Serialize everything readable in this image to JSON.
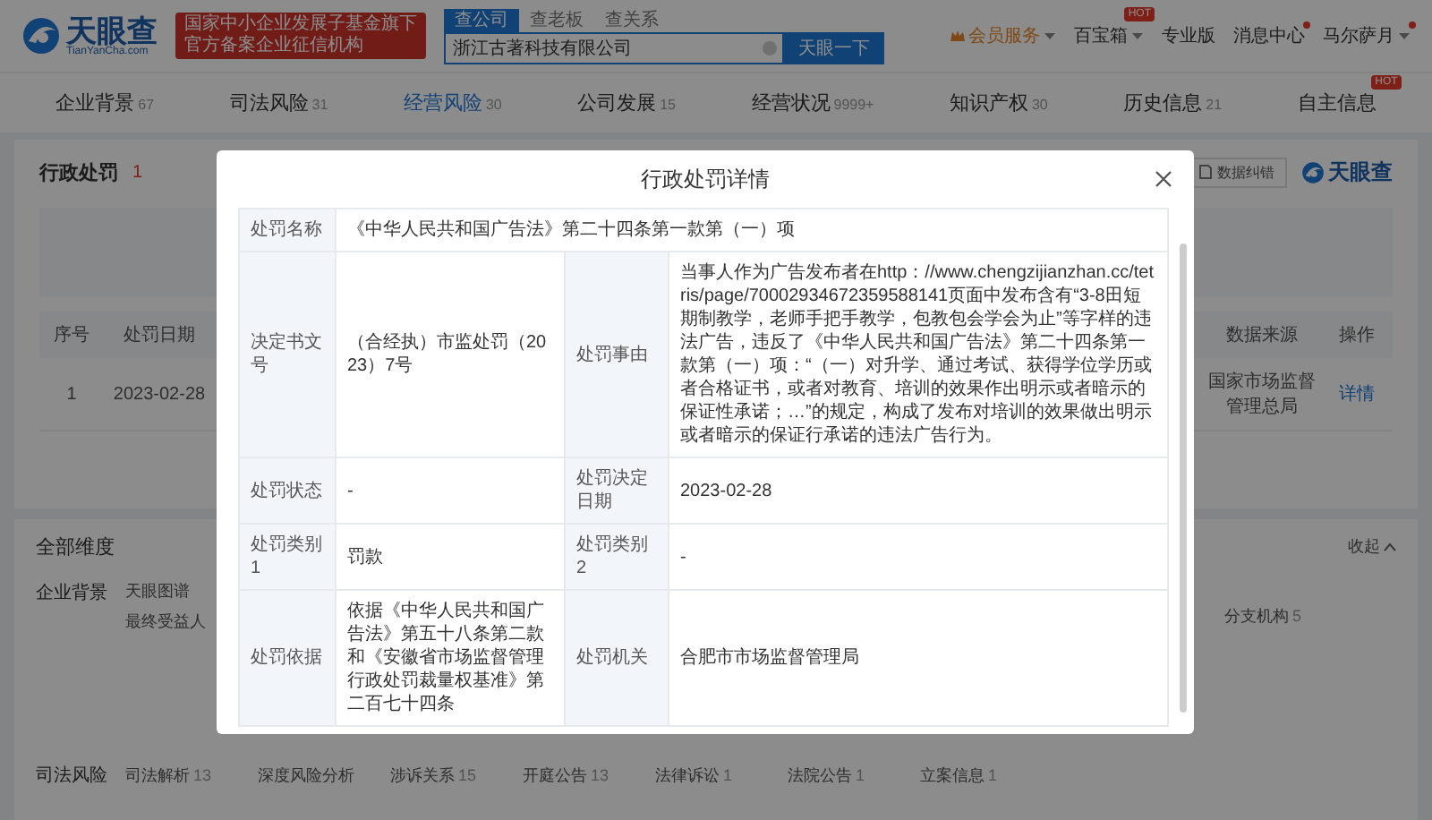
{
  "header": {
    "logo": "天眼查",
    "logo_sub": "TianYanCha.com",
    "banner": [
      "国家中小企业发展子基金旗下",
      "官方备案企业征信机构"
    ],
    "search_tabs": [
      {
        "label": "查公司",
        "selected": true
      },
      {
        "label": "查老板",
        "selected": false
      },
      {
        "label": "查关系",
        "selected": false
      }
    ],
    "search": {
      "value": "浙江古著科技有限公司"
    },
    "search_button": "天眼一下",
    "nav": [
      {
        "label": "会员服务",
        "kind": "vip",
        "dropdown": true,
        "notify": false
      },
      {
        "label": "百宝箱",
        "kind": "link",
        "dropdown": true,
        "notify": false,
        "badge": "HOT"
      },
      {
        "label": "专业版",
        "kind": "link",
        "dropdown": false,
        "notify": false
      },
      {
        "label": "消息中心",
        "kind": "link",
        "dropdown": false,
        "notify": true
      },
      {
        "label": "马尔萨月",
        "kind": "link",
        "dropdown": true,
        "notify": true
      }
    ]
  },
  "tabs": [
    {
      "label": "企业背景",
      "count": "67",
      "selected": false
    },
    {
      "label": "司法风险",
      "count": "31",
      "selected": false
    },
    {
      "label": "经营风险",
      "count": "30",
      "selected": true
    },
    {
      "label": "公司发展",
      "count": "15",
      "selected": false
    },
    {
      "label": "经营状况",
      "count": "9999+",
      "selected": false
    },
    {
      "label": "知识产权",
      "count": "30",
      "selected": false
    },
    {
      "label": "历史信息",
      "count": "21",
      "selected": false
    },
    {
      "label": "自主信息",
      "selected": false,
      "badge": "HOT"
    }
  ],
  "penalty": {
    "title": "行政处罚",
    "count": "1",
    "report_button": "数据纠错",
    "brand": "天眼查",
    "table": {
      "columns": [
        "序号",
        "处罚日期",
        "数据来源",
        "操作"
      ],
      "rows": [
        {
          "cells": [
            "1",
            "2023-02-28",
            "国家市场监督管理总局"
          ],
          "action": "详情"
        }
      ]
    }
  },
  "dimensions": {
    "title": "全部维度",
    "collapse": "收起",
    "groups": [
      {
        "label": "企业背景",
        "items": [
          {
            "label": "天眼图谱"
          },
          {
            "label": "最终受益人"
          }
        ],
        "side_items": [
          {
            "label": "分支机构",
            "count": "5"
          }
        ]
      },
      {
        "label": "司法风险",
        "items": [
          {
            "label": "司法解析",
            "count": "13"
          },
          {
            "label": "深度风险分析"
          },
          {
            "label": "涉诉关系",
            "count": "15"
          },
          {
            "label": "开庭公告",
            "count": "13"
          },
          {
            "label": "法律诉讼",
            "count": "1"
          },
          {
            "label": "法院公告",
            "count": "1"
          },
          {
            "label": "立案信息",
            "count": "1"
          }
        ]
      }
    ]
  },
  "modal": {
    "title": "行政处罚详情",
    "rows": [
      [
        {
          "label": "处罚名称",
          "value": "《中华人民共和国广告法》第二十四条第一款第（一）项"
        }
      ],
      [
        {
          "label": "决定书文号",
          "value": "（合经执）市监处罚（2023）7号"
        },
        {
          "label": "处罚事由",
          "value": "当事人作为广告发布者在http：//www.chengzijianzhan.cc/tetris/page/70002934672359588141页面中发布含有“3-8田短期制教学，老师手把手教学，包教包会学会为止”等字样的违法广告，违反了《中华人民共和国广告法》第二十四条第一款第（一）项：“（一）对升学、通过考试、获得学位学历或者合格证书，或者对教育、培训的效果作出明示或者暗示的保证性承诺；…”的规定，构成了发布对培训的效果做出明示或者暗示的保证行承诺的违法广告行为。"
        }
      ],
      [
        {
          "label": "处罚状态",
          "value": "-"
        },
        {
          "label": "处罚决定日期",
          "value": "2023-02-28"
        }
      ],
      [
        {
          "label": "处罚类别1",
          "value": "罚款"
        },
        {
          "label": "处罚类别2",
          "value": "-"
        }
      ],
      [
        {
          "label": "处罚依据",
          "value": "依据《中华人民共和国广告法》第五十八条第二款和《安徽省市场监督管理行政处罚裁量权基准》第二百七十四条"
        },
        {
          "label": "处罚机关",
          "value": "合肥市市场监督管理局"
        }
      ]
    ]
  }
}
